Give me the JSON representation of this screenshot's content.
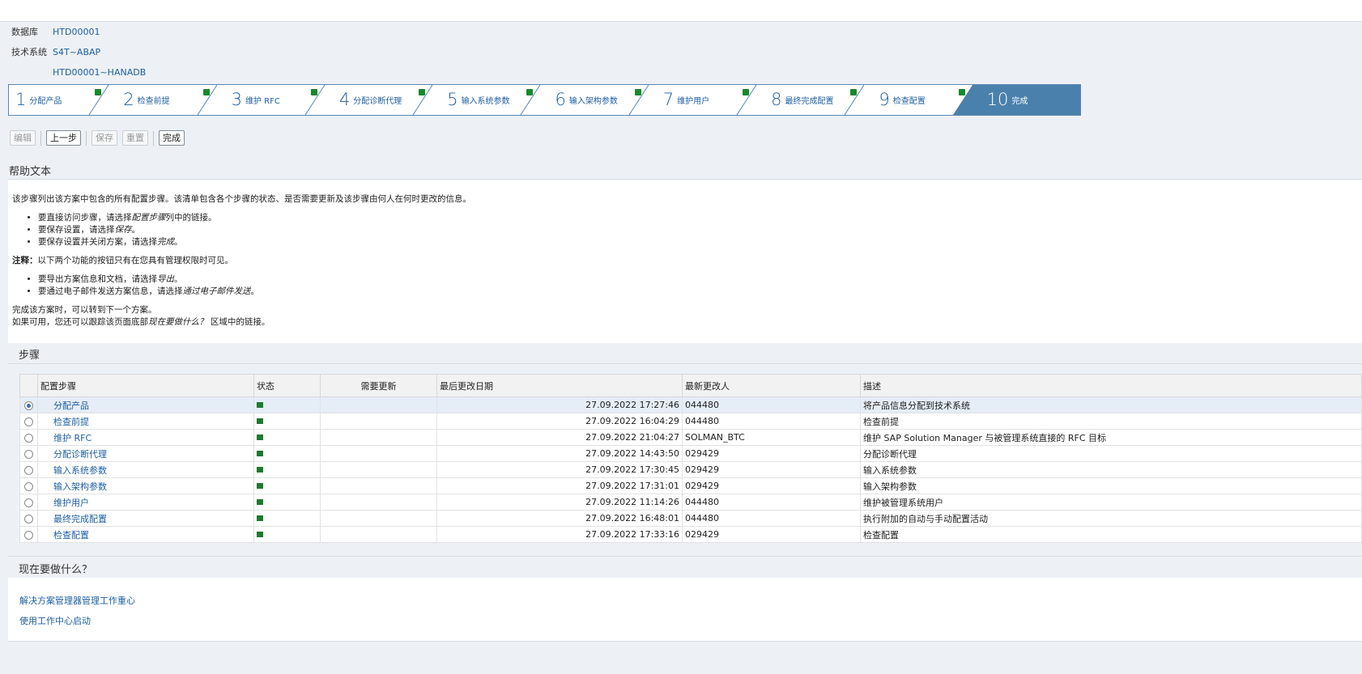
{
  "info": {
    "database_key": "数据库",
    "database_val": "HTD00001",
    "tech_system_key": "技术系统",
    "tech_system_val": "S4T~ABAP",
    "third_val": "HTD00001~HANADB"
  },
  "wizard": {
    "steps": [
      {
        "num": "1",
        "label": "分配产品"
      },
      {
        "num": "2",
        "label": "检查前提"
      },
      {
        "num": "3",
        "label": "维护 RFC"
      },
      {
        "num": "4",
        "label": "分配诊断代理"
      },
      {
        "num": "5",
        "label": "输入系统参数"
      },
      {
        "num": "6",
        "label": "输入架构参数"
      },
      {
        "num": "7",
        "label": "维护用户"
      },
      {
        "num": "8",
        "label": "最终完成配置"
      },
      {
        "num": "9",
        "label": "检查配置"
      },
      {
        "num": "10",
        "label": "完成"
      }
    ],
    "status_color": "#18892b",
    "active_color": "#4a80ac"
  },
  "toolbar": {
    "edit": "编辑",
    "previous": "上一步",
    "save": "保存",
    "reset": "重置",
    "finish": "完成"
  },
  "help": {
    "title": "帮助文本",
    "intro": "该步骤列出该方案中包含的所有配置步骤。该清单包含各个步骤的状态、是否需要更新及该步骤由何人在何时更改的信息。",
    "bullet1_pre": "要直接访问步骤，请选择",
    "bullet1_em": "配置步骤",
    "bullet1_post": "列中的链接。",
    "bullet2_pre": "要保存设置，请选择",
    "bullet2_em": "保存",
    "bullet2_post": "。",
    "bullet3_pre": "要保存设置并关闭方案，请选择",
    "bullet3_em": "完成",
    "bullet3_post": "。",
    "note_bold": "注释：",
    "note_text": "以下两个功能的按钮只有在您具有管理权限时可见。",
    "bullet4_pre": "要导出方案信息和文档，请选择",
    "bullet4_em": "导出",
    "bullet4_post": "。",
    "bullet5_pre": "要通过电子邮件发送方案信息，请选择",
    "bullet5_em": "通过电子邮件发送",
    "bullet5_post": "。",
    "outro1": "完成该方案时，可以转到下一个方案。",
    "outro2_pre": "如果可用，您还可以跟踪该页面底部",
    "outro2_em": "现在要做什么？",
    "outro2_post": " 区域中的链接。"
  },
  "steps_section": {
    "title": "步骤",
    "columns": [
      "",
      "配置步骤",
      "状态",
      "需要更新",
      "最后更改日期",
      "最新更改人",
      "描述"
    ],
    "rows": [
      {
        "step": "分配产品",
        "date": "27.09.2022 17:27:46",
        "user": "044480",
        "desc": "将产品信息分配到技术系统"
      },
      {
        "step": "检查前提",
        "date": "27.09.2022 16:04:29",
        "user": "044480",
        "desc": "检查前提"
      },
      {
        "step": "维护 RFC",
        "date": "27.09.2022 21:04:27",
        "user": "SOLMAN_BTC",
        "desc": "维护 SAP Solution Manager 与被管理系统直接的 RFC 目标"
      },
      {
        "step": "分配诊断代理",
        "date": "27.09.2022 14:43:50",
        "user": "029429",
        "desc": "分配诊断代理"
      },
      {
        "step": "输入系统参数",
        "date": "27.09.2022 17:30:45",
        "user": "029429",
        "desc": "输入系统参数"
      },
      {
        "step": "输入架构参数",
        "date": "27.09.2022 17:31:01",
        "user": "029429",
        "desc": "输入架构参数"
      },
      {
        "step": "维护用户",
        "date": "27.09.2022 11:14:26",
        "user": "044480",
        "desc": "维护被管理系统用户"
      },
      {
        "step": "最终完成配置",
        "date": "27.09.2022 16:48:01",
        "user": "044480",
        "desc": "执行附加的自动与手动配置活动"
      },
      {
        "step": "检查配置",
        "date": "27.09.2022 17:33:16",
        "user": "029429",
        "desc": "检查配置"
      }
    ]
  },
  "whatnow": {
    "title": "现在要做什么？",
    "link1": "解决方案管理器管理工作重心",
    "link2": "使用工作中心启动"
  }
}
